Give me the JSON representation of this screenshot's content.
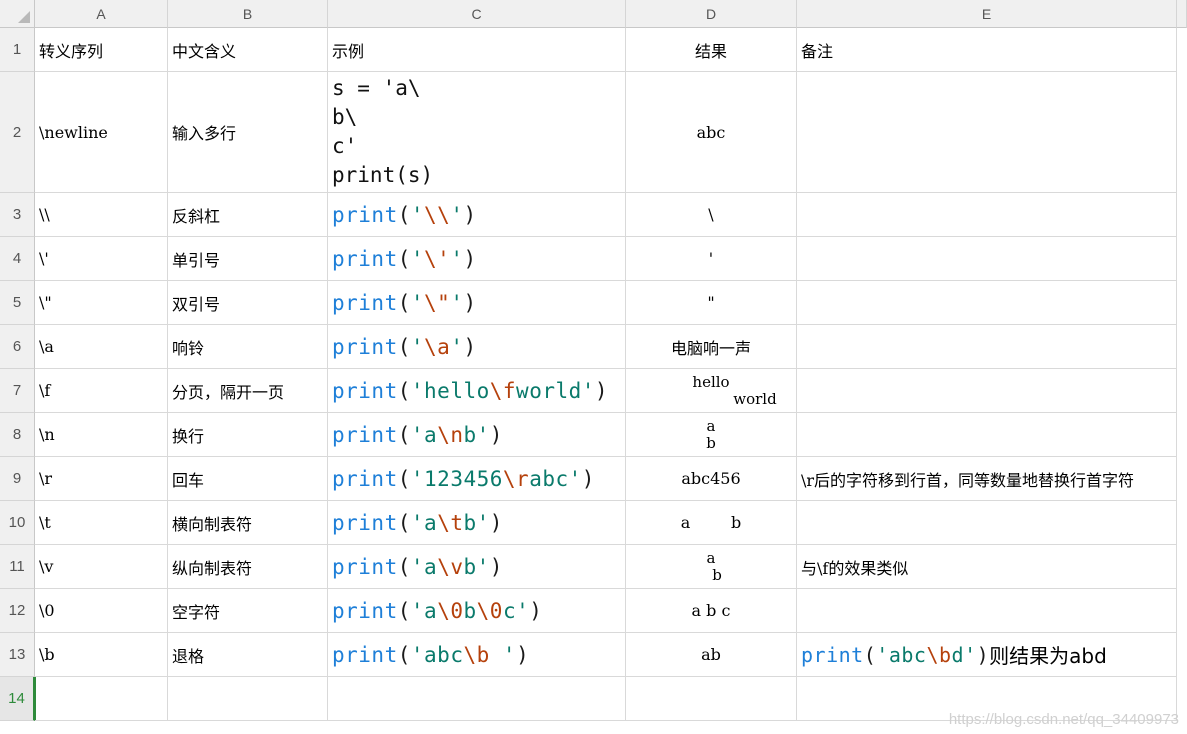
{
  "columns": [
    "A",
    "B",
    "C",
    "D",
    "E"
  ],
  "row_numbers": [
    "1",
    "2",
    "3",
    "4",
    "5",
    "6",
    "7",
    "8",
    "9",
    "10",
    "11",
    "12",
    "13",
    "14"
  ],
  "header_row": {
    "a": "转义序列",
    "b": "中文含义",
    "c": "示例",
    "d": "结果",
    "e": "备注"
  },
  "newline_row": {
    "a": "\\newline",
    "b": "输入多行",
    "c_lines": [
      "s = 'a\\",
      "b\\",
      "c'",
      "print(s)"
    ],
    "d": "abc",
    "e": ""
  },
  "rows": [
    {
      "a": "\\\\",
      "b": "反斜杠",
      "code": {
        "fn": "print",
        "open": "(",
        "q1": "'",
        "pre": "",
        "esc": "\\\\",
        "post": "",
        "q2": "'",
        "close": ")"
      },
      "d": "\\",
      "e": ""
    },
    {
      "a": "\\'",
      "b": "单引号",
      "code": {
        "fn": "print",
        "open": "(",
        "q1": "'",
        "pre": "",
        "esc": "\\'",
        "post": "",
        "q2": "'",
        "close": ")"
      },
      "d": "'",
      "e": ""
    },
    {
      "a": "\\\"",
      "b": "双引号",
      "code": {
        "fn": "print",
        "open": "(",
        "q1": "'",
        "pre": "",
        "esc": "\\\"",
        "post": "",
        "q2": "'",
        "close": ")"
      },
      "d": "\"",
      "e": ""
    },
    {
      "a": "\\a",
      "b": "响铃",
      "code": {
        "fn": "print",
        "open": "(",
        "q1": "'",
        "pre": "",
        "esc": "\\a",
        "post": "",
        "q2": "'",
        "close": ")"
      },
      "d": "电脑响一声",
      "e": ""
    },
    {
      "a": "\\f",
      "b": "分页，隔开一页",
      "code": {
        "fn": "print",
        "open": "(",
        "q1": "'",
        "pre": "hello",
        "esc": "\\f",
        "post": "world",
        "q2": "'",
        "close": ")"
      },
      "d_lines": [
        "hello",
        "world"
      ],
      "e": ""
    },
    {
      "a": "\\n",
      "b": "换行",
      "code": {
        "fn": "print",
        "open": "(",
        "q1": "'",
        "pre": "a",
        "esc": "\\n",
        "post": "b",
        "q2": "'",
        "close": ")"
      },
      "d_lines": [
        "a",
        "b"
      ],
      "e": ""
    },
    {
      "a": "\\r",
      "b": "回车",
      "code": {
        "fn": "print",
        "open": "(",
        "q1": "'",
        "pre": "123456",
        "esc": "\\r",
        "post": "abc",
        "q2": "'",
        "close": ")"
      },
      "d": "abc456",
      "e": "\\r后的字符移到行首，同等数量地替换行首字符"
    },
    {
      "a": "\\t",
      "b": "横向制表符",
      "code": {
        "fn": "print",
        "open": "(",
        "q1": "'",
        "pre": "a",
        "esc": "\\t",
        "post": "b",
        "q2": "'",
        "close": ")"
      },
      "d": "a        b",
      "e": ""
    },
    {
      "a": "\\v",
      "b": "纵向制表符",
      "code": {
        "fn": "print",
        "open": "(",
        "q1": "'",
        "pre": "a",
        "esc": "\\v",
        "post": "b",
        "q2": "'",
        "close": ")"
      },
      "d_lines": [
        "a",
        "b"
      ],
      "e": "与\\f的效果类似"
    },
    {
      "a": "\\0",
      "b": "空字符",
      "code": {
        "fn": "print",
        "open": "(",
        "q1": "'",
        "pre": "a",
        "esc": "\\0",
        "post": "b",
        "esc2": "\\0",
        "post2": "c",
        "q2": "'",
        "close": ")"
      },
      "d": "a b c",
      "e": ""
    },
    {
      "a": "\\b",
      "b": "退格",
      "code": {
        "fn": "print",
        "open": "(",
        "q1": "'",
        "pre": "abc",
        "esc": "\\b",
        "post": " ",
        "q2": "'",
        "close": ")"
      },
      "d": "ab",
      "e_code": {
        "fn": "print",
        "open": "(",
        "q1": "'",
        "pre": "abc",
        "esc": "\\b",
        "post": "d",
        "q2": "'",
        "close": ")",
        "tail": "则结果为abd"
      }
    }
  ],
  "watermark": "https://blog.csdn.net/qq_34409973",
  "colors": {
    "function": "#1e7fd8",
    "string": "#0a7a6b",
    "escape": "#b5410c",
    "active_row": "#2e8b3b"
  }
}
